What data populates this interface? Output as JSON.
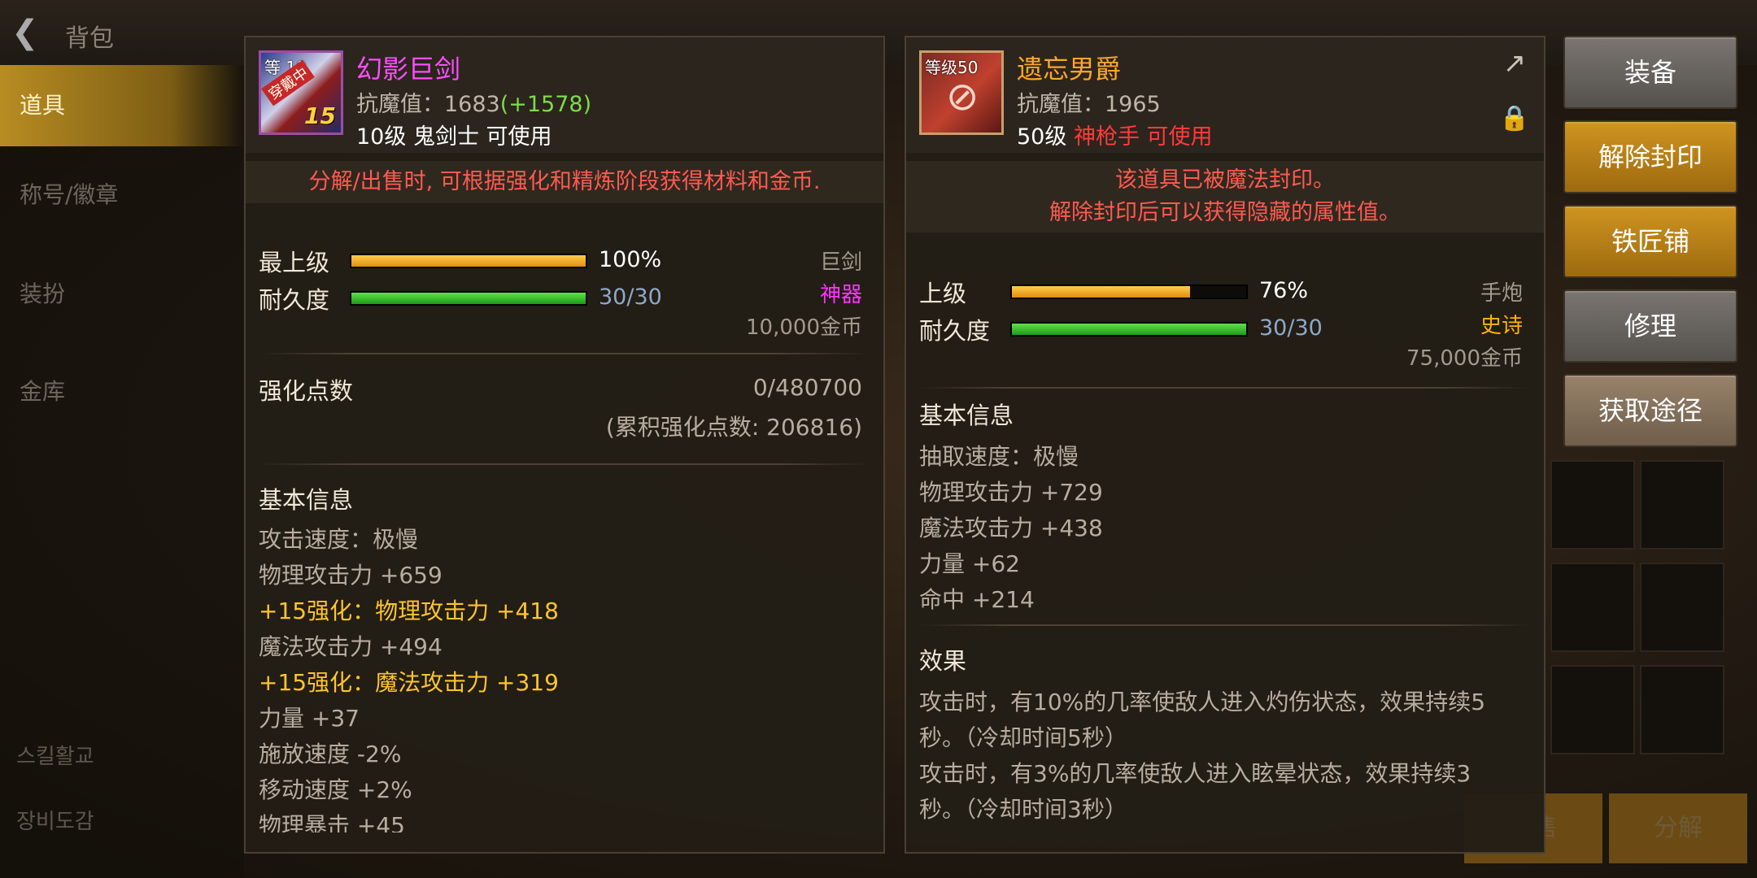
{
  "background": {
    "title": "背包",
    "nav_items": [
      "道具",
      "称号/徽章",
      "装扮",
      "金库"
    ],
    "nav_bottom": [
      "스킬활교",
      "장비도감"
    ]
  },
  "left_item": {
    "name": "幻影巨剑",
    "name_color": "#ff4dff",
    "icon": {
      "level_text": "等 10",
      "stamp": "穿戴中",
      "badge": "15"
    },
    "resist_label": "抗魔值：1683",
    "resist_bonus": "(+1578)",
    "req_level": "10级",
    "req_class": "鬼剑士",
    "req_usable": "可使用",
    "notice": "分解/出售时, 可根据强化和精炼阶段获得材料和金币.",
    "grade_label": "最上级",
    "grade_percent": 100,
    "grade_value": "100%",
    "durability_label": "耐久度",
    "durability_current": 30,
    "durability_max": 30,
    "durability_value": "30/30",
    "type": "巨剑",
    "rarity": "神器",
    "rarity_color": "#ff33ff",
    "price": "10,000金币",
    "enhance_label": "强化点数",
    "enhance_value": "0/480700",
    "enhance_total": "(累积强化点数: 206816)",
    "basic_title": "基本信息",
    "basic_lines": [
      {
        "text": "攻击速度：极慢",
        "highlight": false
      },
      {
        "text": "物理攻击力 +659",
        "highlight": false
      },
      {
        "text": "+15强化：物理攻击力 +418",
        "highlight": true
      },
      {
        "text": "魔法攻击力 +494",
        "highlight": false
      },
      {
        "text": "+15强化：魔法攻击力 +319",
        "highlight": true
      },
      {
        "text": "力量 +37",
        "highlight": false
      },
      {
        "text": "施放速度 -2%",
        "highlight": false
      },
      {
        "text": "移动速度 +2%",
        "highlight": false
      },
      {
        "text": "物理暴击 +45",
        "highlight": false
      }
    ]
  },
  "right_item": {
    "name": "遗忘男爵",
    "name_color": "#ffa726",
    "icon": {
      "level_text": "等级50"
    },
    "resist_label": "抗魔值：1965",
    "req_level": "50级",
    "req_class_usable": "神枪手 可使用",
    "notice_lines": [
      "该道具已被魔法封印。",
      "解除封印后可以获得隐藏的属性值。"
    ],
    "grade_label": "上级",
    "grade_percent": 76,
    "grade_value": "76%",
    "durability_label": "耐久度",
    "durability_current": 30,
    "durability_max": 30,
    "durability_value": "30/30",
    "type": "手炮",
    "rarity": "史诗",
    "rarity_color": "#ffb300",
    "price": "75,000金币",
    "basic_title": "基本信息",
    "basic_lines": [
      "抽取速度：极慢",
      "物理攻击力 +729",
      "魔法攻击力 +438",
      "力量 +62",
      "命中 +214"
    ],
    "effect_title": "效果",
    "effect_lines": [
      "攻击时，有10%的几率使敌人进入灼伤状态，效果持续5",
      "秒。（冷却时间5秒）",
      "攻击时，有3%的几率使敌人进入眩晕状态，效果持续3",
      "秒。（冷却时间3秒）"
    ],
    "share_icon": "share-icon",
    "lock_icon": "lock-icon"
  },
  "actions": [
    {
      "label": "装备",
      "style": "gray"
    },
    {
      "label": "解除封印",
      "style": "gold"
    },
    {
      "label": "铁匠铺",
      "style": "gold"
    },
    {
      "label": "修理",
      "style": "gray"
    },
    {
      "label": "获取途径",
      "style": "brown"
    }
  ],
  "bottom_buttons": [
    "出售",
    "分解"
  ],
  "colors": {
    "gold_text": "#ffc52a",
    "notice_red": "#ff5a50",
    "bonus_green": "#7edc4a"
  }
}
